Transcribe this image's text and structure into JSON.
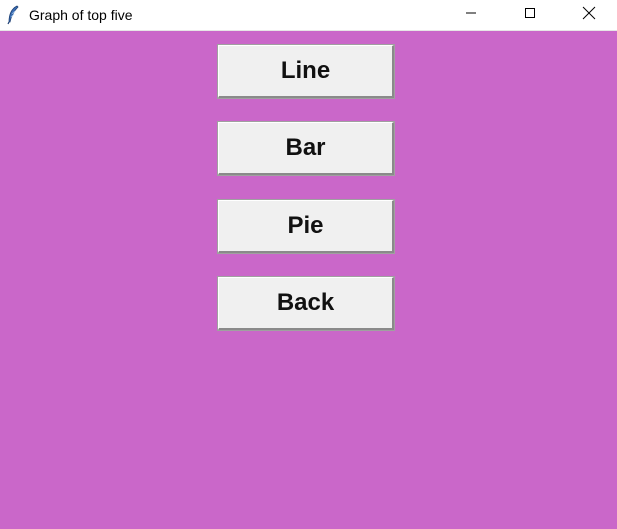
{
  "window": {
    "title": "Graph of top five",
    "background_color": "#ca67c9",
    "icons": {
      "app": "feather-icon",
      "minimize": "minimize-icon",
      "maximize": "maximize-icon",
      "close": "close-icon"
    }
  },
  "buttons": {
    "line_label": "Line",
    "bar_label": "Bar",
    "pie_label": "Pie",
    "back_label": "Back"
  }
}
